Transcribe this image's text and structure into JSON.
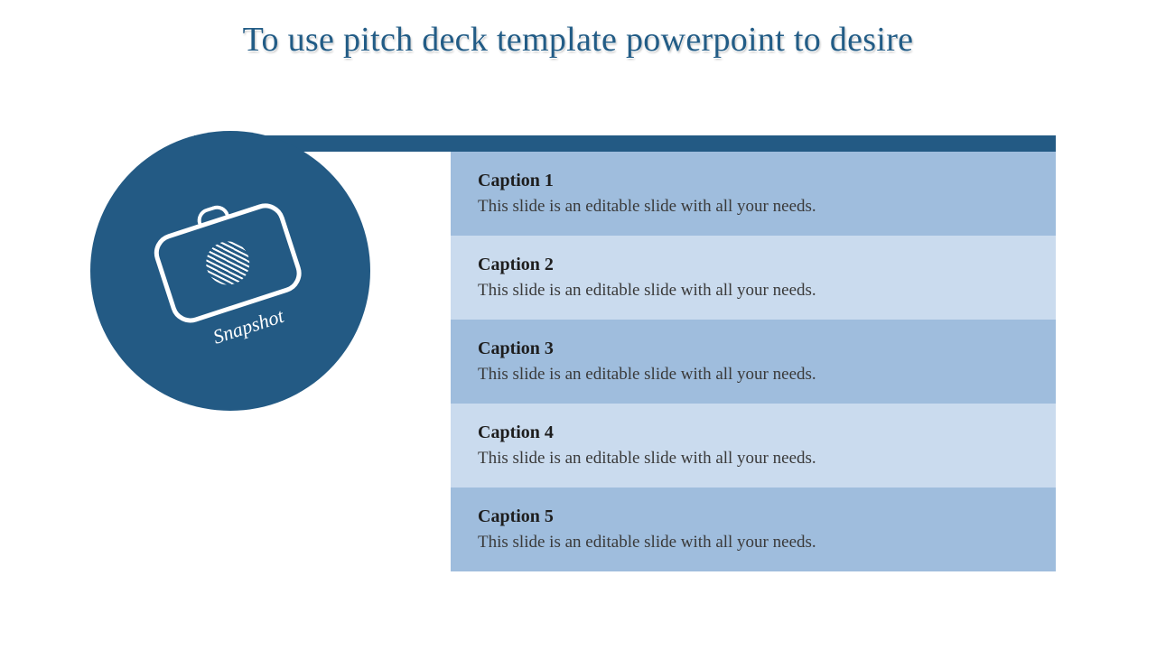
{
  "title": "To use pitch deck template powerpoint to desire",
  "badge": {
    "label": "Snapshot",
    "icon": "camera-icon"
  },
  "colors": {
    "primary": "#235a84",
    "rowA": "#9fbddd",
    "rowB": "#cadbee"
  },
  "captions": [
    {
      "title": "Caption 1",
      "desc": "This slide is an editable slide with all your needs."
    },
    {
      "title": "Caption 2",
      "desc": "This slide is an editable slide with all your needs."
    },
    {
      "title": "Caption 3",
      "desc": "This slide is an editable slide with all your needs."
    },
    {
      "title": "Caption 4",
      "desc": "This slide is an editable slide with all your needs."
    },
    {
      "title": "Caption 5",
      "desc": "This slide is an editable slide with all your needs."
    }
  ]
}
